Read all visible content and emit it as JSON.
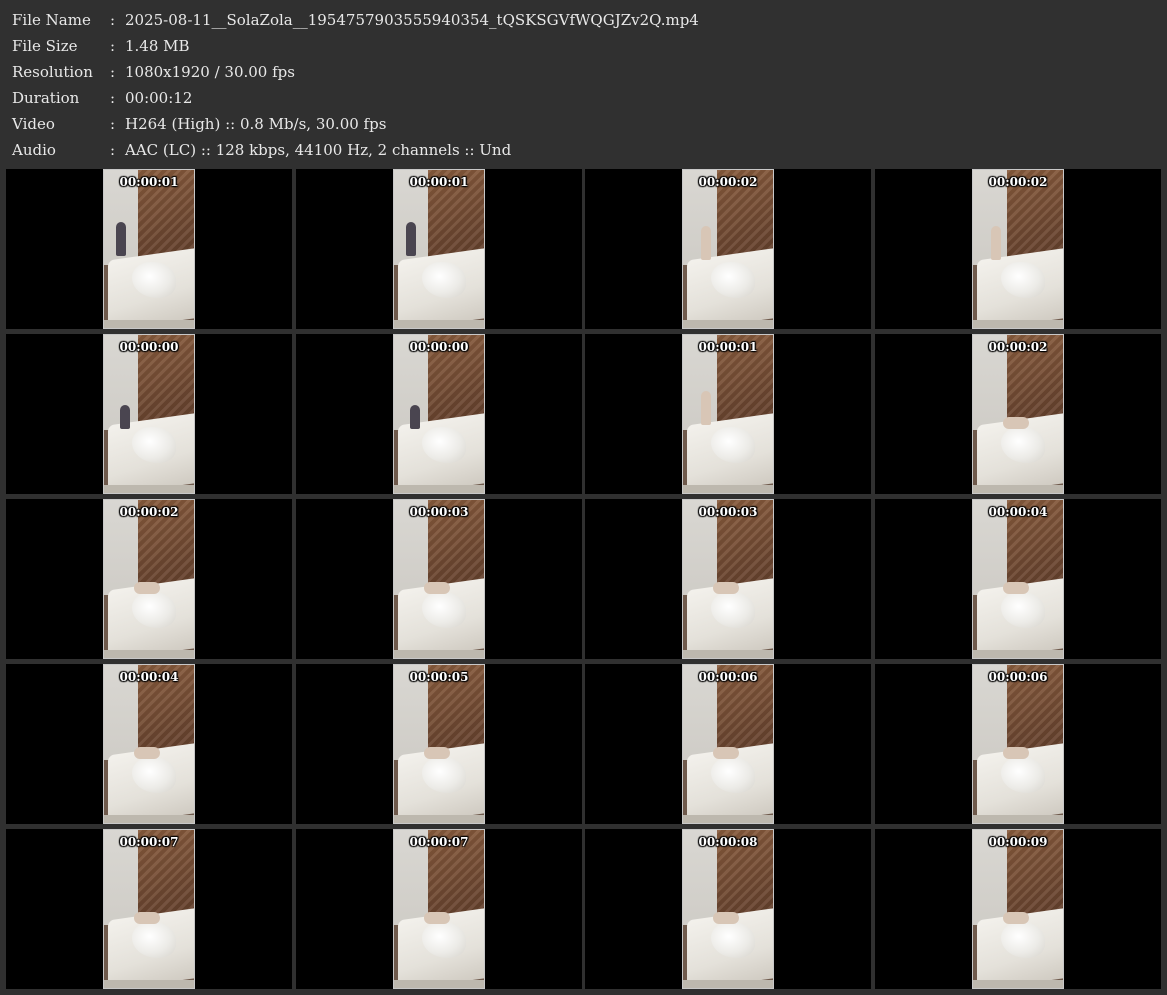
{
  "info": [
    {
      "label": "File Name",
      "sep": ":",
      "value": "2025-08-11__SolaZola__1954757903555940354_tQSKSGVfWQGJZv2Q.mp4"
    },
    {
      "label": "File Size",
      "sep": ":",
      "value": "1.48 MB"
    },
    {
      "label": "Resolution",
      "sep": ":",
      "value": "1080x1920 / 30.00 fps"
    },
    {
      "label": "Duration",
      "sep": ":",
      "value": "00:00:12"
    },
    {
      "label": "Video",
      "sep": ":",
      "value": "H264 (High) :: 0.8 Mb/s, 30.00 fps"
    },
    {
      "label": "Audio",
      "sep": ":",
      "value": "AAC (LC) :: 128 kbps, 44100 Hz, 2 channels :: Und"
    }
  ],
  "thumbnails": [
    {
      "time": "00:00:01",
      "scene": "standing-dark"
    },
    {
      "time": "00:00:01",
      "scene": "standing-dark"
    },
    {
      "time": "00:00:02",
      "scene": "standing-light"
    },
    {
      "time": "00:00:02",
      "scene": "standing-light"
    },
    {
      "time": "00:00:00",
      "scene": "sitting"
    },
    {
      "time": "00:00:00",
      "scene": "sitting"
    },
    {
      "time": "00:00:01",
      "scene": "standing-light"
    },
    {
      "time": "00:00:02",
      "scene": "lying"
    },
    {
      "time": "00:00:02",
      "scene": "lying"
    },
    {
      "time": "00:00:03",
      "scene": "lying"
    },
    {
      "time": "00:00:03",
      "scene": "lying"
    },
    {
      "time": "00:00:04",
      "scene": "lying"
    },
    {
      "time": "00:00:04",
      "scene": "lying"
    },
    {
      "time": "00:00:05",
      "scene": "lying"
    },
    {
      "time": "00:00:06",
      "scene": "lying"
    },
    {
      "time": "00:00:06",
      "scene": "lying"
    },
    {
      "time": "00:00:07",
      "scene": "lying"
    },
    {
      "time": "00:00:07",
      "scene": "lying"
    },
    {
      "time": "00:00:08",
      "scene": "lying"
    },
    {
      "time": "00:00:09",
      "scene": "lying"
    }
  ]
}
